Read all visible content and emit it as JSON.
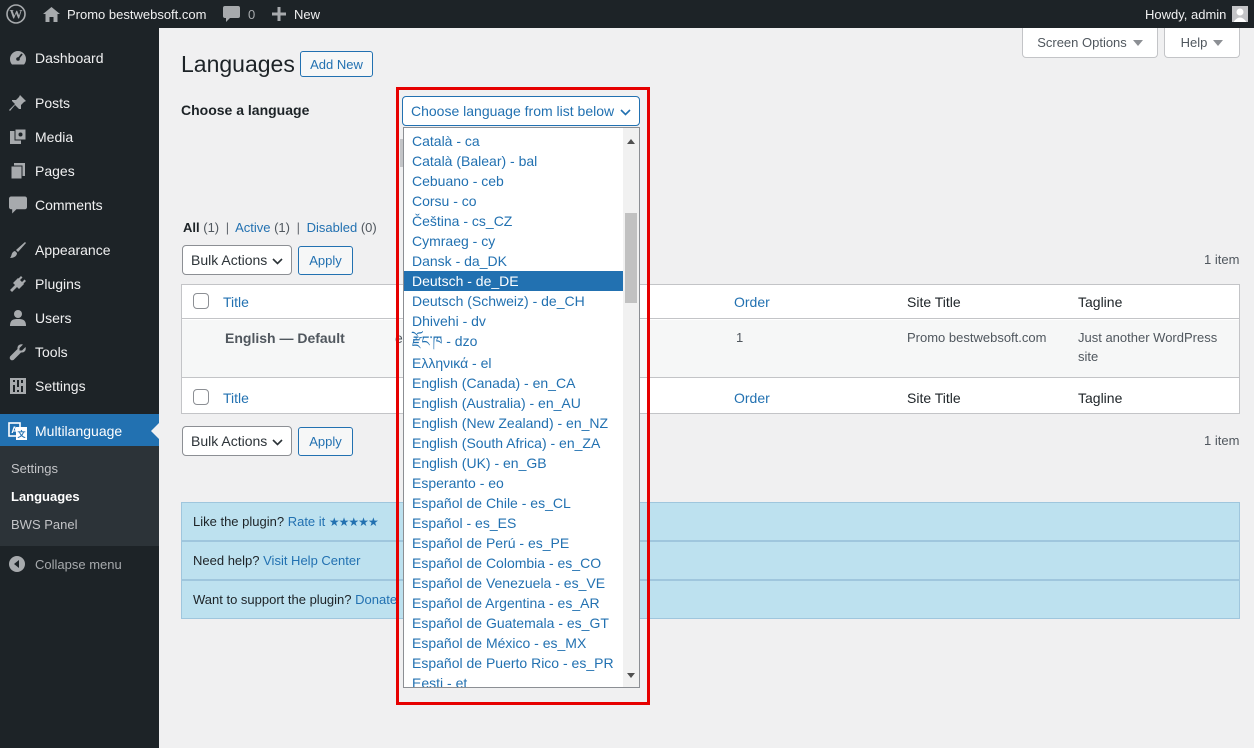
{
  "adminbar": {
    "site_name": "Promo bestwebsoft.com",
    "comments_count": "0",
    "new_label": "New",
    "howdy": "Howdy, admin"
  },
  "sidebar": {
    "items": [
      {
        "label": "Dashboard",
        "icon": "dashboard-icon"
      },
      {
        "label": "Posts",
        "icon": "pin-icon"
      },
      {
        "label": "Media",
        "icon": "media-icon"
      },
      {
        "label": "Pages",
        "icon": "pages-icon"
      },
      {
        "label": "Comments",
        "icon": "comment-icon"
      },
      {
        "label": "Appearance",
        "icon": "brush-icon"
      },
      {
        "label": "Plugins",
        "icon": "plug-icon"
      },
      {
        "label": "Users",
        "icon": "user-icon"
      },
      {
        "label": "Tools",
        "icon": "wrench-icon"
      },
      {
        "label": "Settings",
        "icon": "settings-icon"
      },
      {
        "label": "Multilanguage",
        "icon": "translate-icon"
      }
    ],
    "submenu": [
      "Settings",
      "Languages",
      "BWS Panel"
    ],
    "collapse": "Collapse menu"
  },
  "header": {
    "title": "Languages",
    "add_new": "Add New",
    "screen_options": "Screen Options",
    "help": "Help"
  },
  "chooser": {
    "label": "Choose a language",
    "select_value": "Choose language from list below"
  },
  "filters": {
    "all": "All",
    "all_count": "(1)",
    "sep": "|",
    "active": "Active",
    "active_count": "(1)",
    "disabled": "Disabled",
    "disabled_count": "(0)"
  },
  "bulk": {
    "label": "Bulk Actions",
    "apply": "Apply",
    "items_count": "1 item"
  },
  "table": {
    "headers": {
      "title": "Title",
      "order": "Order",
      "site_title": "Site Title",
      "tagline": "Tagline"
    },
    "row": {
      "title": "English — Default",
      "prefix": "e",
      "order": "1",
      "site_title": "Promo bestwebsoft.com",
      "tagline_1": "Just another WordPress",
      "tagline_2": "site"
    }
  },
  "notices": {
    "rate_text": "Like the plugin?",
    "rate_link": "Rate it",
    "stars": "★★★★★",
    "help_text": "Need help?",
    "help_link": "Visit Help Center",
    "support_text": "Want to support the plugin?",
    "support_link": "Donate"
  },
  "dropdown": {
    "selected": "Deutsch - de_DE",
    "options": [
      "Català - ca",
      "Català (Balear) - bal",
      "Cebuano - ceb",
      "Corsu - co",
      "Čeština - cs_CZ",
      "Cymraeg - cy",
      "Dansk - da_DK",
      "Deutsch - de_DE",
      "Deutsch (Schweiz) - de_CH",
      "Dhivehi - dv",
      "རྫོང་ཁ - dzo",
      "Ελληνικά - el",
      "English (Canada) - en_CA",
      "English (Australia) - en_AU",
      "English (New Zealand) - en_NZ",
      "English (South Africa) - en_ZA",
      "English (UK) - en_GB",
      "Esperanto - eo",
      "Español de Chile - es_CL",
      "Español - es_ES",
      "Español de Perú - es_PE",
      "Español de Colombia - es_CO",
      "Español de Venezuela - es_VE",
      "Español de Argentina - es_AR",
      "Español de Guatemala - es_GT",
      "Español de México - es_MX",
      "Español de Puerto Rico - es_PR",
      "Eesti - et"
    ]
  }
}
